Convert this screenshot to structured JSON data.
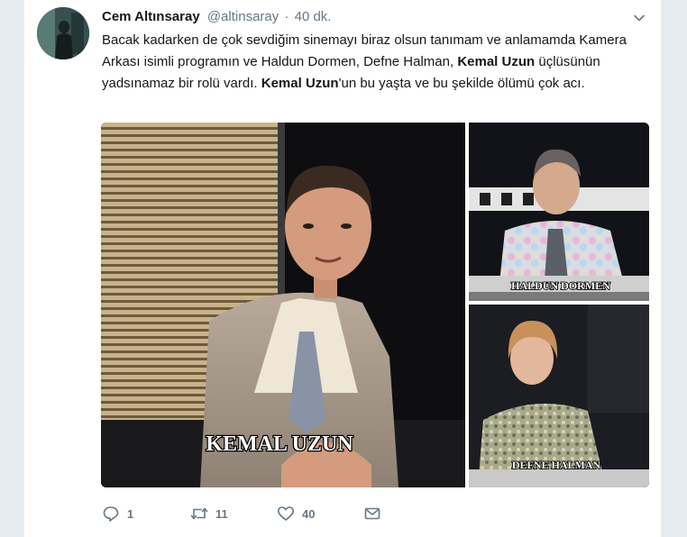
{
  "tweet": {
    "author_name": "Cem Altınsaray",
    "author_handle": "@altinsaray",
    "separator": "·",
    "time": "40 dk.",
    "text_parts": [
      "Bacak kadarken de çok sevdiğim sinemayı biraz olsun tanımam ve anlamamda Kamera Arkası isimli programın ve Haldun Dormen, Defne Halman, ",
      "Kemal Uzun",
      " üçlüsünün yadsınamaz bir rolü vardı. ",
      "Kemal Uzun",
      "'un bu yaşta ve bu şekilde ölümü çok acı."
    ]
  },
  "media": {
    "captions": {
      "main": "KEMAL UZUN",
      "top_right": "HALDUN DORMEN",
      "bottom_right": "DEFNE HALMAN"
    }
  },
  "actions": {
    "reply_count": "1",
    "retweet_count": "11",
    "like_count": "40"
  },
  "icons": {
    "reply": "reply-icon",
    "retweet": "retweet-icon",
    "like": "heart-icon",
    "message": "envelope-icon",
    "menu": "chevron-down-icon"
  },
  "colors": {
    "text": "#14171a",
    "secondary": "#657786",
    "background": "#e6ecf0"
  }
}
